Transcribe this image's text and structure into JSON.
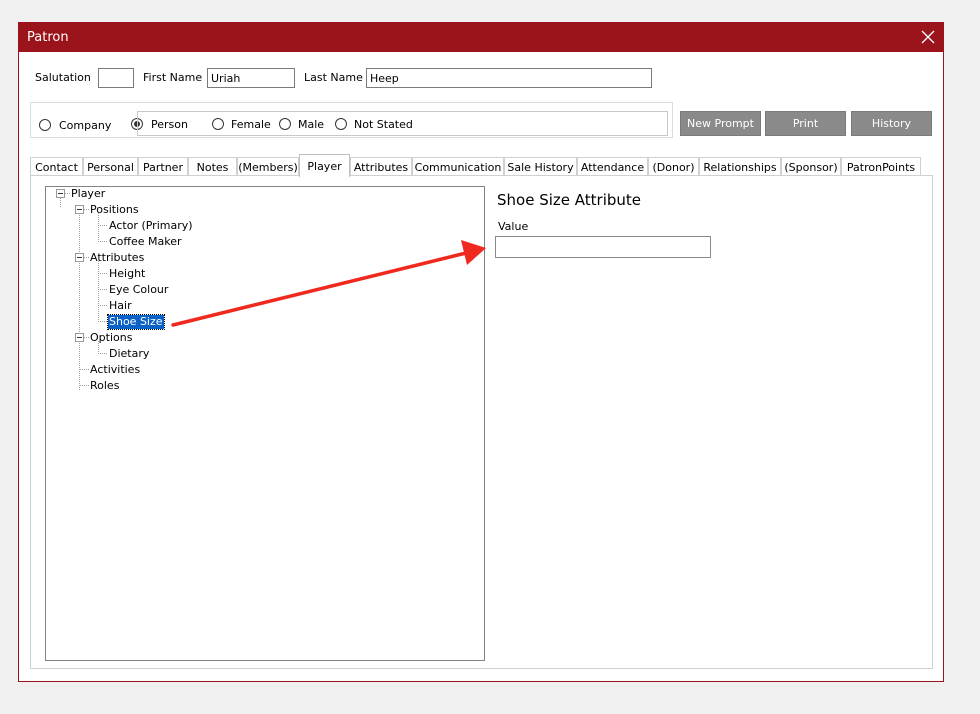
{
  "window": {
    "title": "Patron"
  },
  "header": {
    "salutation_label": "Salutation",
    "salutation_value": "",
    "first_name_label": "First Name",
    "first_name_value": "Uriah",
    "last_name_label": "Last Name",
    "last_name_value": "Heep"
  },
  "patron_type": {
    "company_label": "Company",
    "person_label": "Person",
    "selected": "Person"
  },
  "gender": {
    "female_label": "Female",
    "male_label": "Male",
    "not_stated_label": "Not Stated",
    "selected": ""
  },
  "actions": {
    "new_prompt": "New Prompt",
    "print": "Print",
    "history": "History"
  },
  "tabs": [
    {
      "label": "Contact"
    },
    {
      "label": "Personal"
    },
    {
      "label": "Partner"
    },
    {
      "label": "Notes"
    },
    {
      "label": "(Members)"
    },
    {
      "label": "Player"
    },
    {
      "label": "Attributes"
    },
    {
      "label": "Communication"
    },
    {
      "label": "Sale History"
    },
    {
      "label": "Attendance"
    },
    {
      "label": "(Donor)"
    },
    {
      "label": "Relationships"
    },
    {
      "label": "(Sponsor)"
    },
    {
      "label": "PatronPoints"
    }
  ],
  "active_tab": "Player",
  "tree": {
    "root": "Player",
    "positions": {
      "label": "Positions",
      "children": [
        "Actor (Primary)",
        "Coffee Maker"
      ]
    },
    "attributes": {
      "label": "Attributes",
      "children": [
        "Height",
        "Eye Colour",
        "Hair",
        "Shoe Size"
      ]
    },
    "options": {
      "label": "Options",
      "children": [
        "Dietary"
      ]
    },
    "activities": "Activities",
    "roles": "Roles",
    "selected": "Shoe Size"
  },
  "detail": {
    "title": "Shoe Size Attribute",
    "value_label": "Value",
    "value": ""
  },
  "colors": {
    "titlebar": "#9b141b",
    "button_gray": "#8a8a8a",
    "selection": "#0a62c9",
    "annotation_arrow": "#f0291f"
  }
}
